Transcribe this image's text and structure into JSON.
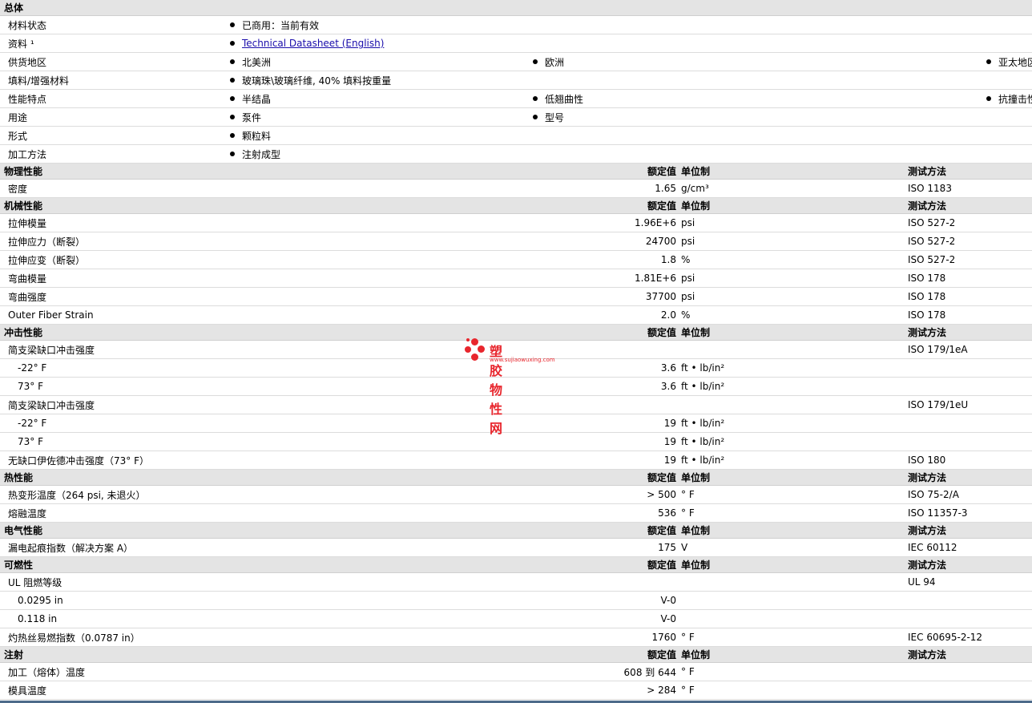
{
  "general": {
    "title": "总体",
    "rows": [
      {
        "label": "材料状态",
        "items": [
          "已商用：当前有效"
        ]
      },
      {
        "label": "资料 ¹",
        "link": "Technical Datasheet (English)"
      },
      {
        "label": "供货地区",
        "items": [
          "北美洲",
          "欧洲",
          "亚太地区"
        ]
      },
      {
        "label": "填料/增强材料",
        "items": [
          "玻璃珠\\玻璃纤维, 40% 填料按重量"
        ]
      },
      {
        "label": "性能特点",
        "items": [
          "半结晶",
          "低翘曲性",
          "抗撞击性，良好"
        ]
      },
      {
        "label": "用途",
        "items": [
          "泵件",
          "型号"
        ]
      },
      {
        "label": "形式",
        "items": [
          "颗粒料"
        ]
      },
      {
        "label": "加工方法",
        "items": [
          "注射成型"
        ]
      }
    ]
  },
  "headers": {
    "value": "额定值",
    "unit": "单位制",
    "method": "测试方法"
  },
  "sections": [
    {
      "title": "物理性能",
      "rows": [
        {
          "label": "密度",
          "value": "1.65",
          "unit": "g/cm³",
          "method": "ISO 1183"
        }
      ]
    },
    {
      "title": "机械性能",
      "rows": [
        {
          "label": "拉伸模量",
          "value": "1.96E+6",
          "unit": "psi",
          "method": "ISO 527-2"
        },
        {
          "label": "拉伸应力（断裂）",
          "value": "24700",
          "unit": "psi",
          "method": "ISO 527-2"
        },
        {
          "label": "拉伸应变（断裂）",
          "value": "1.8",
          "unit": "%",
          "method": "ISO 527-2"
        },
        {
          "label": "弯曲模量",
          "value": "1.81E+6",
          "unit": "psi",
          "method": "ISO 178"
        },
        {
          "label": "弯曲强度",
          "value": "37700",
          "unit": "psi",
          "method": "ISO 178"
        },
        {
          "label": "Outer Fiber Strain",
          "value": "2.0",
          "unit": "%",
          "method": "ISO 178"
        }
      ]
    },
    {
      "title": "冲击性能",
      "rows": [
        {
          "label": "简支梁缺口冲击强度",
          "value": "",
          "unit": "",
          "method": "ISO 179/1eA"
        },
        {
          "label": "-22° F",
          "value": "3.6",
          "unit": "ft • lb/in²",
          "method": "",
          "sub": true
        },
        {
          "label": "73° F",
          "value": "3.6",
          "unit": "ft • lb/in²",
          "method": "",
          "sub": true
        },
        {
          "label": "简支梁缺口冲击强度",
          "value": "",
          "unit": "",
          "method": "ISO 179/1eU"
        },
        {
          "label": "-22° F",
          "value": "19",
          "unit": "ft • lb/in²",
          "method": "",
          "sub": true
        },
        {
          "label": "73° F",
          "value": "19",
          "unit": "ft • lb/in²",
          "method": "",
          "sub": true
        },
        {
          "label": "无缺口伊佐德冲击强度（73° F）",
          "value": "19",
          "unit": "ft • lb/in²",
          "method": "ISO 180"
        }
      ]
    },
    {
      "title": "热性能",
      "rows": [
        {
          "label": "热变形温度（264 psi, 未退火）",
          "value": "> 500",
          "unit": "° F",
          "method": "ISO 75-2/A"
        },
        {
          "label": "熔融温度",
          "value": "536",
          "unit": "° F",
          "method": "ISO 11357-3"
        }
      ]
    },
    {
      "title": "电气性能",
      "rows": [
        {
          "label": "漏电起痕指数（解决方案 A）",
          "value": "175",
          "unit": "V",
          "method": "IEC 60112"
        }
      ]
    },
    {
      "title": "可燃性",
      "rows": [
        {
          "label": "UL 阻燃等级",
          "value": "",
          "unit": "",
          "method": "UL 94"
        },
        {
          "label": "0.0295 in",
          "value": "V-0",
          "unit": "",
          "method": "",
          "sub": true
        },
        {
          "label": "0.118 in",
          "value": "V-0",
          "unit": "",
          "method": "",
          "sub": true
        },
        {
          "label": "灼热丝易燃指数（0.0787 in）",
          "value": "1760",
          "unit": "° F",
          "method": "IEC 60695-2-12"
        }
      ]
    },
    {
      "title": "注射",
      "rows": [
        {
          "label": "加工（熔体）温度",
          "value": "608 到 644",
          "unit": "° F",
          "method": ""
        },
        {
          "label": "模具温度",
          "value": "> 284",
          "unit": "° F",
          "method": ""
        }
      ]
    }
  ],
  "watermark": {
    "title": "塑胶物性网",
    "url": "www.sujiaowuxing.com",
    "color": "#e8262d"
  }
}
